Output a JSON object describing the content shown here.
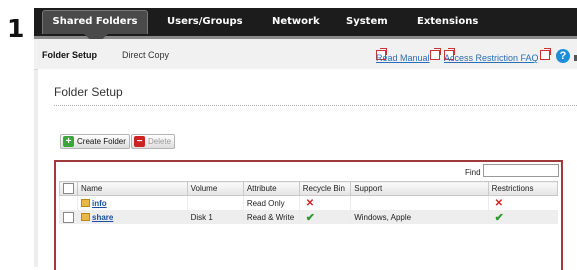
{
  "step_number": "1",
  "top_nav": {
    "tabs": [
      "Shared Folders",
      "Users/Groups",
      "Network",
      "System",
      "Extensions"
    ]
  },
  "sub_nav": {
    "tabs": [
      "Folder Setup",
      "Direct Copy"
    ],
    "links": [
      "Read Manual",
      "Access Restriction FAQ"
    ],
    "help": "?"
  },
  "page": {
    "title": "Folder Setup"
  },
  "toolbar": {
    "create_label": "Create Folder",
    "delete_label": "Delete"
  },
  "find": {
    "label": "Find",
    "value": ""
  },
  "table": {
    "headers": [
      "",
      "Name",
      "Volume",
      "Attribute",
      "Recycle Bin",
      "Support",
      "Restrictions"
    ],
    "rows": [
      {
        "name": "info",
        "volume": "",
        "attribute": "Read Only",
        "recycle": "✕",
        "support": "",
        "restrictions": "✕"
      },
      {
        "name": "share",
        "volume": "Disk 1",
        "attribute": "Read & Write",
        "recycle": "✔",
        "support": "Windows, Apple",
        "restrictions": "✔"
      }
    ]
  }
}
